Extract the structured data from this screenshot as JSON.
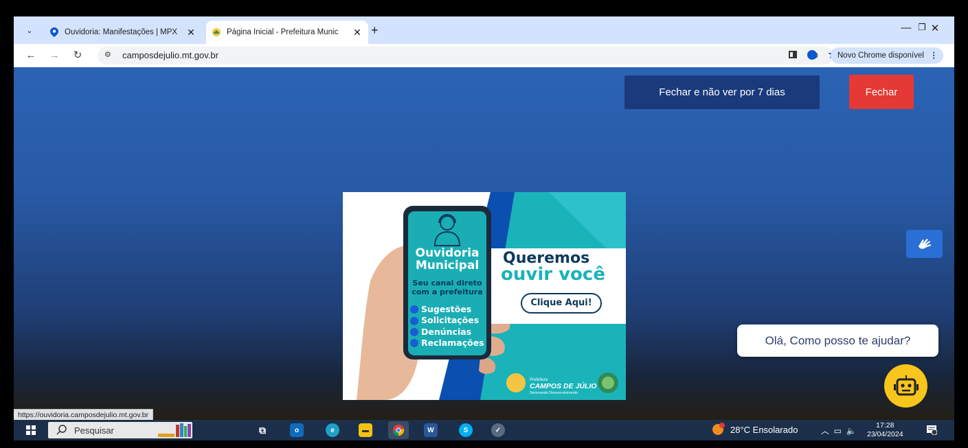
{
  "browser": {
    "tabs": [
      {
        "title": "Ouvidoria: Manifestações | MPX",
        "active": false
      },
      {
        "title": "Página Inicial - Prefeitura Munic",
        "active": true
      }
    ],
    "new_tab": "+",
    "url": "camposdejulio.mt.gov.br",
    "update_label": "Novo Chrome disponível",
    "status_url": "https://ouvidoria.camposdejulio.mt.gov.br"
  },
  "page": {
    "close_7days_label": "Fechar e não ver por 7 dias",
    "close_label": "Fechar",
    "banner": {
      "title_line1": "Ouvidoria",
      "title_line2": "Municipal",
      "subtitle_line1": "Seu canal direto",
      "subtitle_line2": "com a prefeitura",
      "items": [
        "Sugestões",
        "Solicitações",
        "Denúncias",
        "Reclamações"
      ],
      "headline_line1": "Queremos",
      "headline_line2": "ouvir você",
      "cta": "Clique Aqui!",
      "logo_prefix": "Prefeitura",
      "logo_name": "CAMPOS DE JÚLIO",
      "logo_tagline": "Semeando Desenvolvimento"
    },
    "chat_prompt": "Olá, Como posso te ajudar?"
  },
  "taskbar": {
    "search_label": "Pesquisar",
    "weather": "28°C  Ensolarado",
    "time": "17:28",
    "date": "23/04/2024"
  },
  "colors": {
    "popup_button_dark": "#1a3a7c",
    "popup_button_red": "#e53935",
    "chatbot_yellow": "#f7c51b",
    "banner_teal": "#1ab3b9",
    "banner_blue": "#0b4fb0"
  }
}
